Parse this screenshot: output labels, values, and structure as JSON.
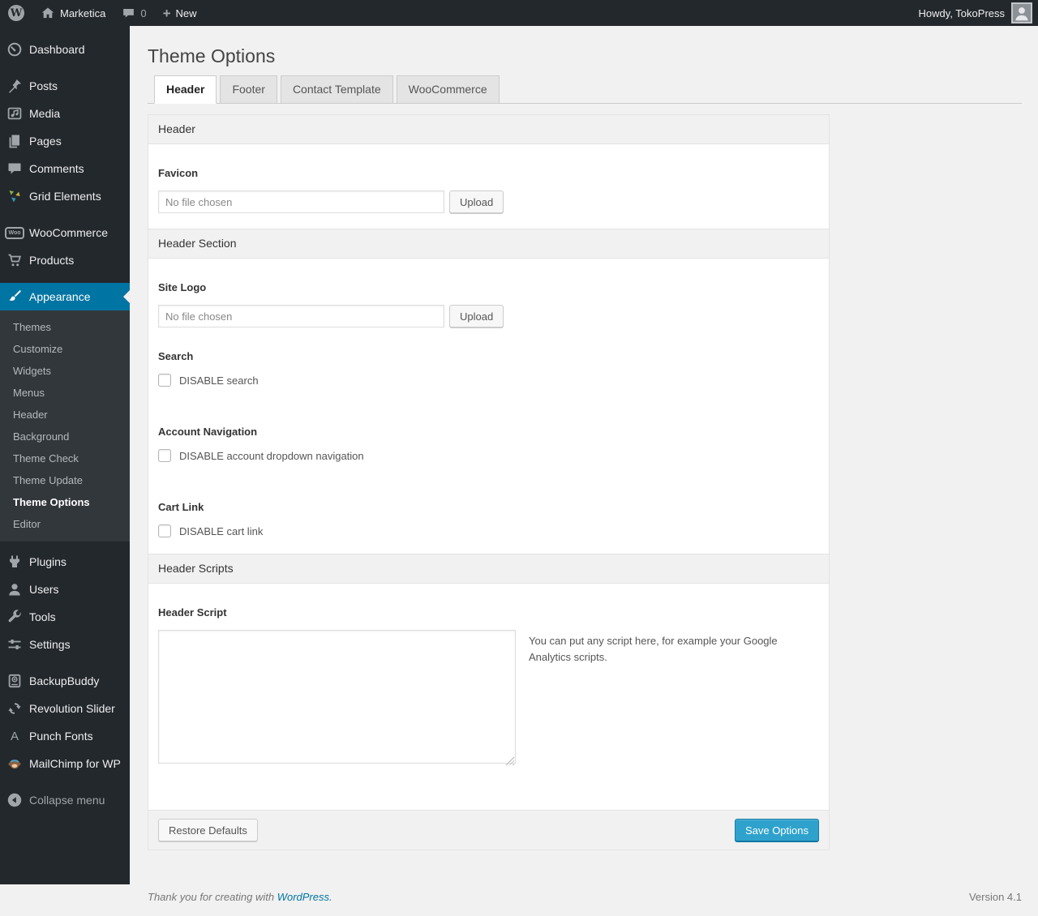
{
  "admin_bar": {
    "wp_letter": "W",
    "site_name": "Marketica",
    "comment_count": "0",
    "new_label": "New",
    "howdy": "Howdy, TokoPress"
  },
  "sidebar": {
    "items": [
      {
        "label": "Dashboard"
      },
      {
        "label": "Posts"
      },
      {
        "label": "Media"
      },
      {
        "label": "Pages"
      },
      {
        "label": "Comments"
      },
      {
        "label": "Grid Elements"
      },
      {
        "label": "WooCommerce"
      },
      {
        "label": "Products"
      },
      {
        "label": "Appearance"
      },
      {
        "label": "Plugins"
      },
      {
        "label": "Users"
      },
      {
        "label": "Tools"
      },
      {
        "label": "Settings"
      },
      {
        "label": "BackupBuddy"
      },
      {
        "label": "Revolution Slider"
      },
      {
        "label": "Punch Fonts"
      },
      {
        "label": "MailChimp for WP"
      }
    ],
    "appearance_submenu": [
      {
        "label": "Themes"
      },
      {
        "label": "Customize"
      },
      {
        "label": "Widgets"
      },
      {
        "label": "Menus"
      },
      {
        "label": "Header"
      },
      {
        "label": "Background"
      },
      {
        "label": "Theme Check"
      },
      {
        "label": "Theme Update"
      },
      {
        "label": "Theme Options",
        "current": true
      },
      {
        "label": "Editor"
      }
    ],
    "woo_badge_text": "Woo",
    "fonts_icon_letter": "A",
    "collapse_label": "Collapse menu"
  },
  "page": {
    "title": "Theme Options",
    "tabs": [
      {
        "label": "Header",
        "active": true
      },
      {
        "label": "Footer"
      },
      {
        "label": "Contact Template"
      },
      {
        "label": "WooCommerce"
      }
    ]
  },
  "panel": {
    "section_header": "Header",
    "favicon": {
      "label": "Favicon",
      "file_value": "No file chosen",
      "upload_label": "Upload"
    },
    "section_header_section": "Header Section",
    "site_logo": {
      "label": "Site Logo",
      "file_value": "No file chosen",
      "upload_label": "Upload"
    },
    "search": {
      "label": "Search",
      "checkbox_label": "DISABLE search"
    },
    "account_nav": {
      "label": "Account Navigation",
      "checkbox_label": "DISABLE account dropdown navigation"
    },
    "cart_link": {
      "label": "Cart Link",
      "checkbox_label": "DISABLE cart link"
    },
    "section_scripts": "Header Scripts",
    "header_script": {
      "label": "Header Script",
      "note": "You can put any script here, for example your Google Analytics scripts."
    },
    "restore_label": "Restore Defaults",
    "save_label": "Save Options"
  },
  "footer": {
    "thanks_prefix": "Thank you for creating with ",
    "wordpress_link": "WordPress.",
    "version": "Version 4.1"
  },
  "colors": {
    "accent_blue": "#0074a2",
    "button_primary_blue": "#2ea2cc",
    "menu_bg": "#23282d",
    "submenu_bg": "#32373c",
    "page_bg": "#f1f1f1"
  }
}
